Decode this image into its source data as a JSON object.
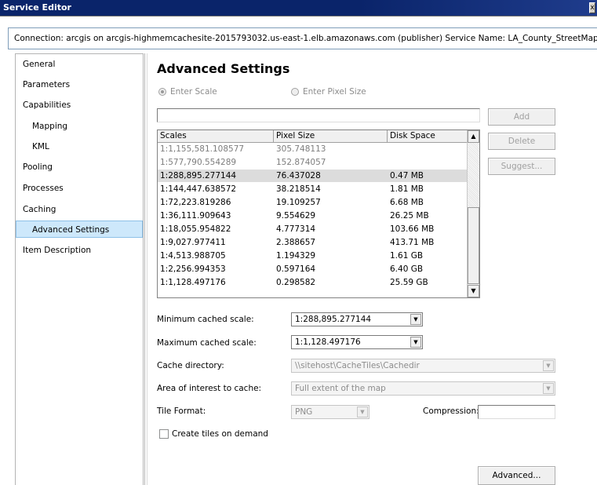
{
  "window": {
    "title": "Service Editor",
    "close_glyph": "x"
  },
  "connection": {
    "text": "Connection: arcgis on arcgis-highmemcachesite-2015793032.us-east-1.elb.amazonaws.com (publisher)   Service Name: LA_County_StreetMap"
  },
  "sidebar": {
    "items": [
      {
        "label": "General"
      },
      {
        "label": "Parameters"
      },
      {
        "label": "Capabilities"
      },
      {
        "label": "Mapping"
      },
      {
        "label": "KML"
      },
      {
        "label": "Pooling"
      },
      {
        "label": "Processes"
      },
      {
        "label": "Caching"
      },
      {
        "label": "Advanced Settings"
      },
      {
        "label": "Item Description"
      }
    ],
    "selected": "Advanced Settings"
  },
  "main": {
    "heading": "Advanced Settings",
    "radio_scale": "Enter Scale",
    "radio_pixel": "Enter Pixel Size",
    "scale_input": "",
    "buttons": {
      "add": "Add",
      "delete": "Delete",
      "suggest": "Suggest...",
      "advanced": "Advanced..."
    },
    "table": {
      "headers": [
        "Scales",
        "Pixel Size",
        "Disk Space"
      ],
      "rows": [
        {
          "scale": "1:1,155,581.108577",
          "pixel": "305.748113",
          "disk": ""
        },
        {
          "scale": "1:577,790.554289",
          "pixel": "152.874057",
          "disk": ""
        },
        {
          "scale": "1:288,895.277144",
          "pixel": "76.437028",
          "disk": "0.47 MB"
        },
        {
          "scale": "1:144,447.638572",
          "pixel": "38.218514",
          "disk": "1.81 MB"
        },
        {
          "scale": "1:72,223.819286",
          "pixel": "19.109257",
          "disk": "6.68 MB"
        },
        {
          "scale": "1:36,111.909643",
          "pixel": "9.554629",
          "disk": "26.25 MB"
        },
        {
          "scale": "1:18,055.954822",
          "pixel": "4.777314",
          "disk": "103.66 MB"
        },
        {
          "scale": "1:9,027.977411",
          "pixel": "2.388657",
          "disk": "413.71 MB"
        },
        {
          "scale": "1:4,513.988705",
          "pixel": "1.194329",
          "disk": "1.61 GB"
        },
        {
          "scale": "1:2,256.994353",
          "pixel": "0.597164",
          "disk": "6.40 GB"
        },
        {
          "scale": "1:1,128.497176",
          "pixel": "0.298582",
          "disk": "25.59 GB"
        }
      ]
    },
    "fields": {
      "min_label": "Minimum cached scale:",
      "min_value": "1:288,895.277144",
      "max_label": "Maximum cached scale:",
      "max_value": "1:1,128.497176",
      "cache_dir_label": "Cache directory:",
      "cache_dir_value": "\\\\sitehost\\CacheTiles\\Cachedir",
      "aoi_label": "Area of interest to cache:",
      "aoi_value": "Full extent of the map",
      "tile_format_label": "Tile Format:",
      "tile_format_value": "PNG",
      "compression_label": "Compression:",
      "compression_value": "",
      "create_on_demand_label": "Create tiles on demand"
    }
  },
  "icons": {
    "dropdown": "chevron-down-icon",
    "scroll_up": "arrow-up-icon",
    "scroll_down": "arrow-down-icon"
  }
}
